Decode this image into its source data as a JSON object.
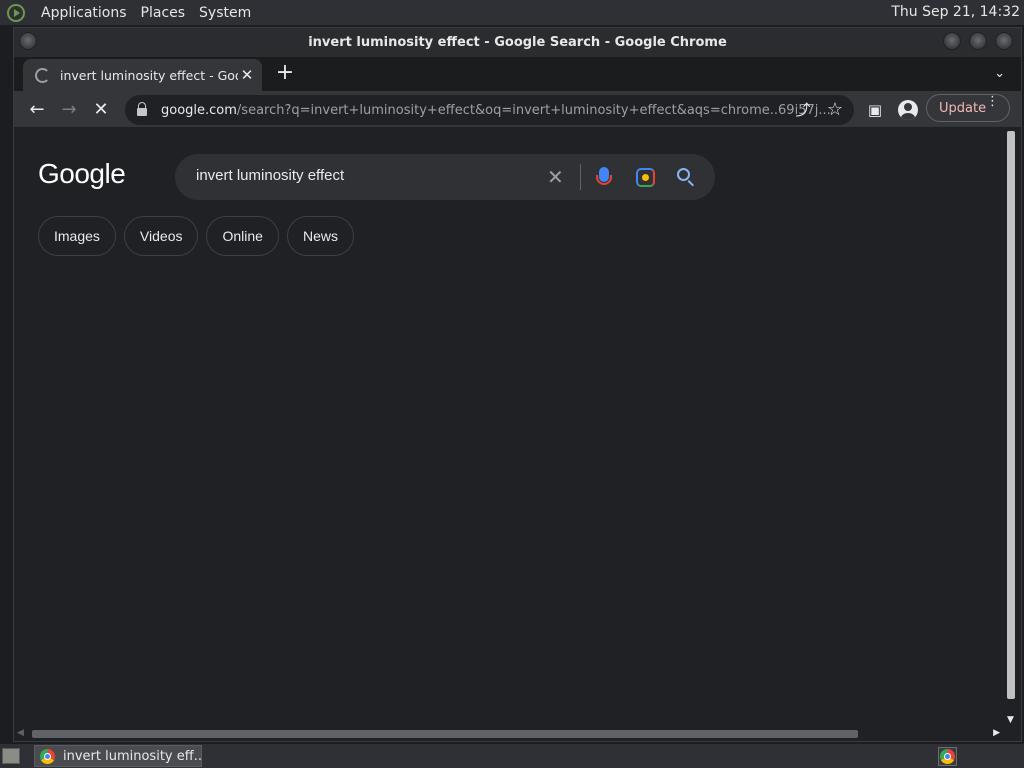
{
  "system_panel": {
    "menus": [
      "Applications",
      "Places",
      "System"
    ],
    "clock": "Thu Sep 21, 14:32"
  },
  "window": {
    "title": "invert luminosity effect - Google Search - Google Chrome"
  },
  "tabs": [
    {
      "title": "invert luminosity effect - Goog",
      "close": "✕"
    }
  ],
  "new_tab": "+",
  "tab_search": "⌄",
  "toolbar": {
    "back": "←",
    "forward": "→",
    "stop": "✕",
    "url_host": "google.com",
    "url_rest": "/search?q=invert+luminosity+effect&oq=invert+luminosity+effect&aqs=chrome..69i57j...",
    "share": "⤴",
    "bookmark": "☆",
    "side_panel": "▣",
    "update_label": "Update",
    "menu_dots": "⋮"
  },
  "page": {
    "logo": "Google",
    "search_query": "invert luminosity effect",
    "clear": "✕",
    "chips": [
      "Images",
      "Videos",
      "Online",
      "News"
    ]
  },
  "scrollbars": {
    "down_arrow": "▼",
    "left_arrow": "◀",
    "right_arrow": "▶"
  },
  "taskbar": {
    "item_label": "invert luminosity eff..."
  },
  "icons": {
    "system_logo": "system-logo-icon",
    "lock": "lock-icon",
    "mic": "mic-icon",
    "lens": "lens-icon",
    "search": "search-icon",
    "chrome": "chrome-icon"
  },
  "colors": {
    "page_bg": "#202124",
    "toolbar_bg": "#35363a",
    "update_text": "#f2b8b5",
    "link_blue": "#8ab4f8"
  }
}
